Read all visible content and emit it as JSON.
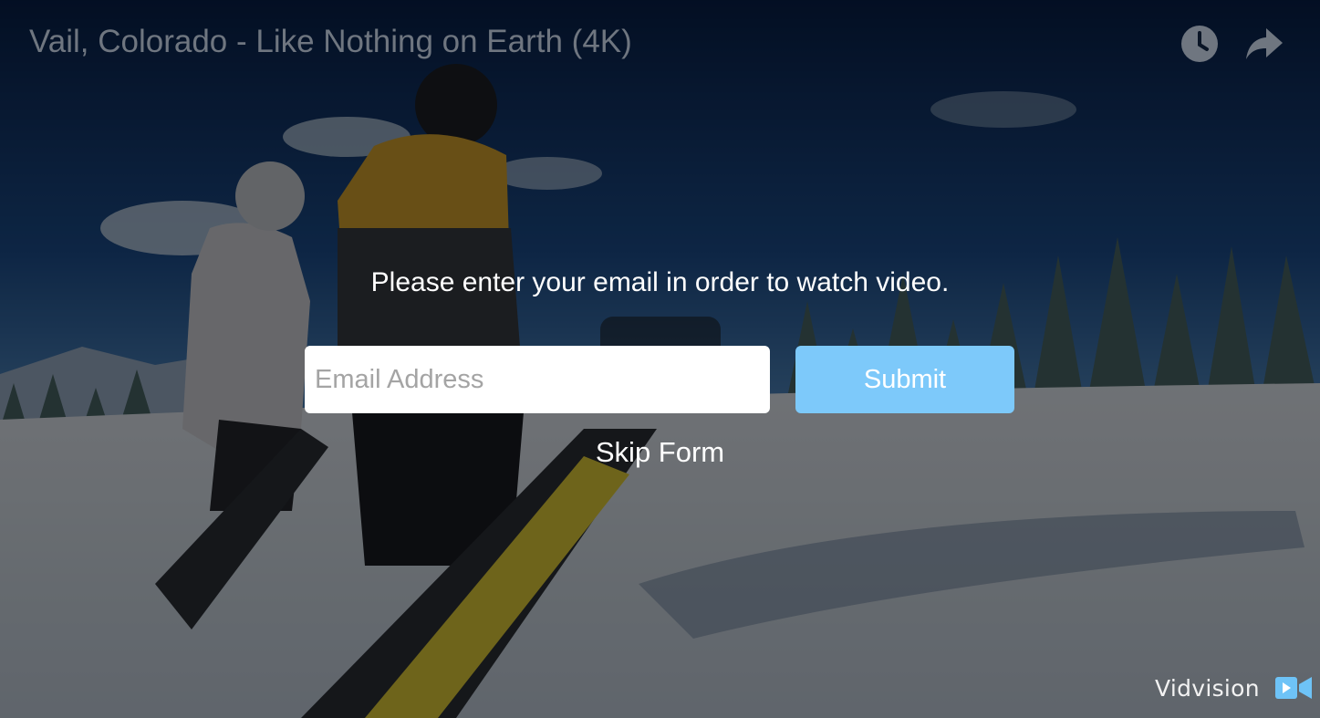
{
  "video": {
    "title": "Vail, Colorado - Like Nothing on Earth (4K)"
  },
  "controls": {
    "watch_later_icon": "clock-icon",
    "share_icon": "share-arrow-icon"
  },
  "gate_form": {
    "prompt": "Please enter your email in order to watch video.",
    "email_placeholder": "Email Address",
    "email_value": "",
    "submit_label": "Submit",
    "skip_label": "Skip Form"
  },
  "branding": {
    "name": "Vidvision",
    "icon": "video-camera-icon"
  },
  "colors": {
    "submit_button": "#7dc9fa",
    "overlay": "rgba(0,0,0,0.52)",
    "title_text": "#6f7680"
  }
}
